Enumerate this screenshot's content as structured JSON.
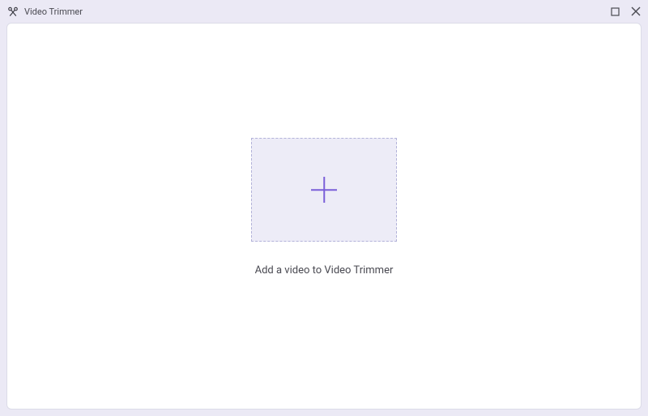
{
  "titlebar": {
    "app_title": "Video Trimmer"
  },
  "main": {
    "instruction": "Add a video to Video Trimmer"
  }
}
